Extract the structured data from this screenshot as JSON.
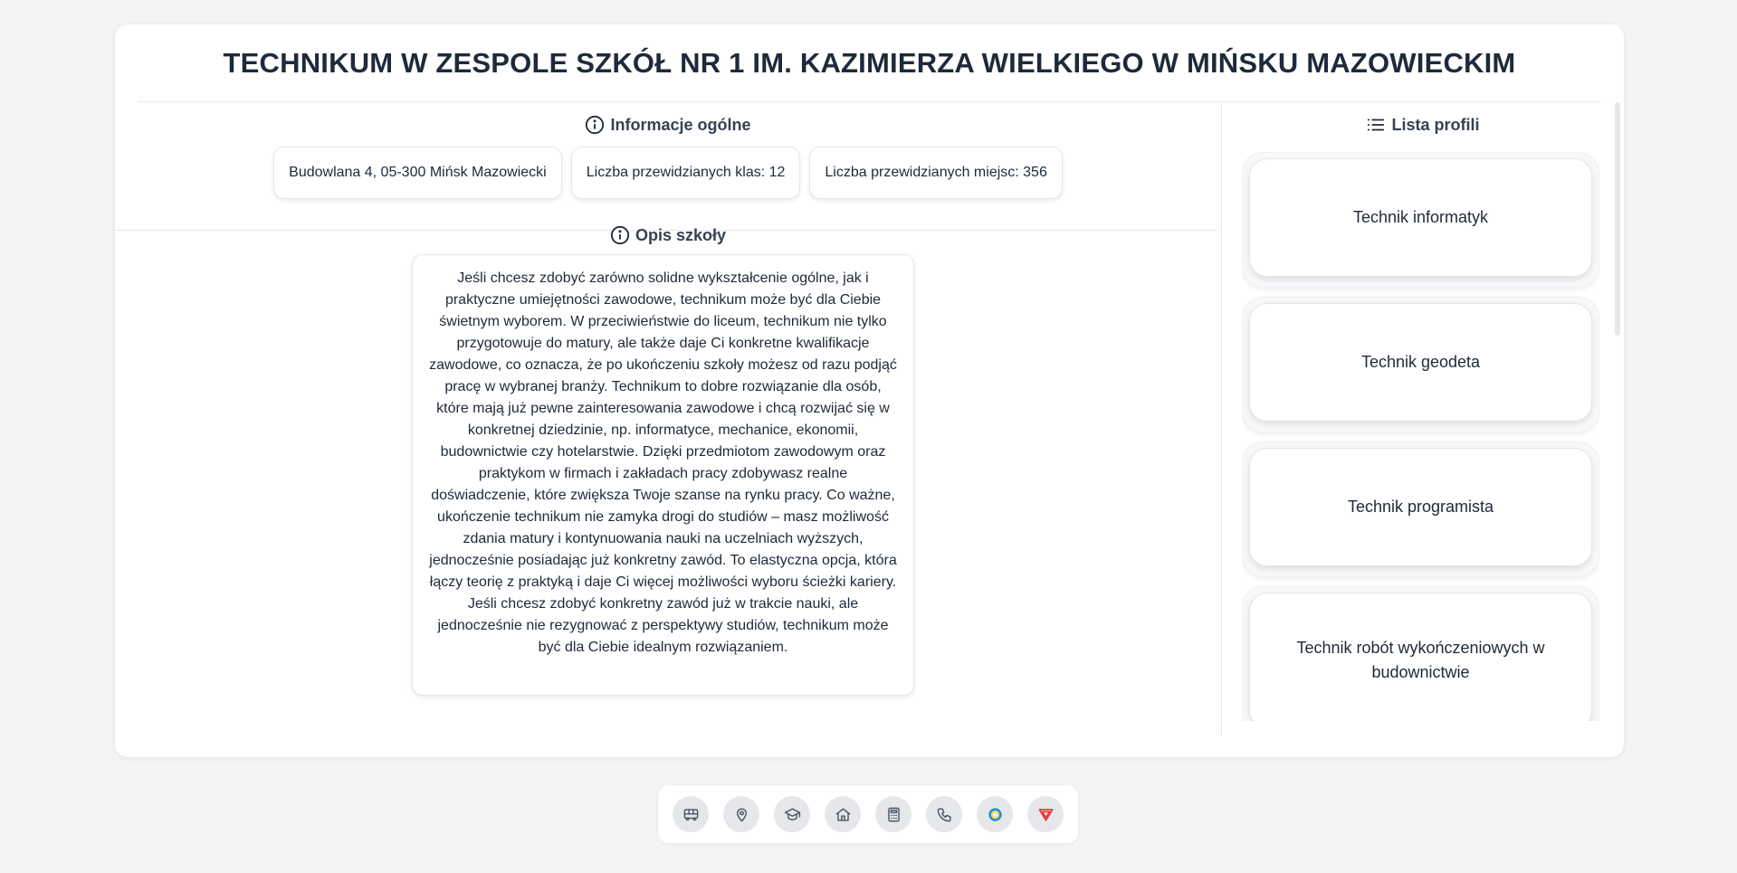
{
  "school": {
    "title": "TECHNIKUM W ZESPOLE SZKÓŁ NR 1 IM. KAZIMIERZA WIELKIEGO W MIŃSKU MAZOWIECKIM"
  },
  "general": {
    "heading": "Informacje ogólne",
    "address": "Budowlana 4, 05-300 Mińsk Mazowiecki",
    "classes": "Liczba przewidzianych klas: 12",
    "seats": "Liczba przewidzianych miejsc: 356"
  },
  "description": {
    "heading": "Opis szkoły",
    "text": "Jeśli chcesz zdobyć zarówno solidne wykształcenie ogólne, jak i praktyczne umiejętności zawodowe, technikum może być dla Ciebie świetnym wyborem. W przeciwieństwie do liceum, technikum nie tylko przygotowuje do matury, ale także daje Ci konkretne kwalifikacje zawodowe, co oznacza, że po ukończeniu szkoły możesz od razu podjąć pracę w wybranej branży. Technikum to dobre rozwiązanie dla osób, które mają już pewne zainteresowania zawodowe i chcą rozwijać się w konkretnej dziedzinie, np. informatyce, mechanice, ekonomii, budownictwie czy hotelarstwie. Dzięki przedmiotom zawodowym oraz praktykom w firmach i zakładach pracy zdobywasz realne doświadczenie, które zwiększa Twoje szanse na rynku pracy. Co ważne, ukończenie technikum nie zamyka drogi do studiów – masz możliwość zdania matury i kontynuowania nauki na uczelniach wyższych, jednocześnie posiadając już konkretny zawód. To elastyczna opcja, która łączy teorię z praktyką i daje Ci więcej możliwości wyboru ścieżki kariery. Jeśli chcesz zdobyć konkretny zawód już w trakcie nauki, ale jednocześnie nie rezygnować z perspektywy studiów, technikum może być dla Ciebie idealnym rozwiązaniem."
  },
  "profiles": {
    "heading": "Lista profili",
    "items": [
      "Technik informatyk",
      "Technik geodeta",
      "Technik programista",
      "Technik robót wykończeniowych w budownictwie"
    ]
  },
  "toolbar": {
    "icons": [
      "bus-icon",
      "map-pin-icon",
      "graduation-cap-icon",
      "home-icon",
      "calculator-icon",
      "phone-icon",
      "circle-logo-icon",
      "shield-logo-icon"
    ],
    "accent_colors": {
      "blue": "#1e88e5",
      "yellow": "#fdd835",
      "red": "#e53935"
    }
  }
}
